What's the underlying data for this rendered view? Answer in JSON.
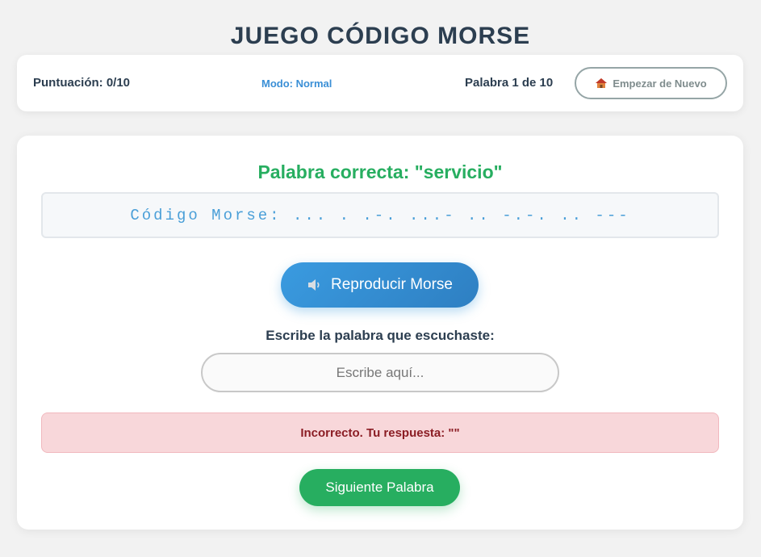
{
  "app": {
    "title": "JUEGO CÓDIGO MORSE"
  },
  "status": {
    "score": "Puntuación: 0/10",
    "mode": "Modo: Normal",
    "progress": "Palabra 1 de 10",
    "restart_label": "Empezar de Nuevo",
    "restart_icon": "house-icon"
  },
  "game": {
    "correct_word": "Palabra correcta: \"servicio\"",
    "morse_text": "Código Morse: ... . .-. ...- .. -.-. .. ---",
    "play_label": "Reproducir Morse",
    "play_icon": "speaker-icon",
    "prompt": "Escribe la palabra que escuchaste:",
    "input_value": "",
    "input_placeholder": "Escribe aquí...",
    "feedback": "Incorrecto. Tu respuesta: \"\"",
    "next_label": "Siguiente Palabra"
  },
  "colors": {
    "primary_text": "#2c3e50",
    "success": "#27ae60",
    "accent_blue": "#3498db",
    "error_bg": "#f8d7da",
    "error_text": "#8b1d24"
  }
}
